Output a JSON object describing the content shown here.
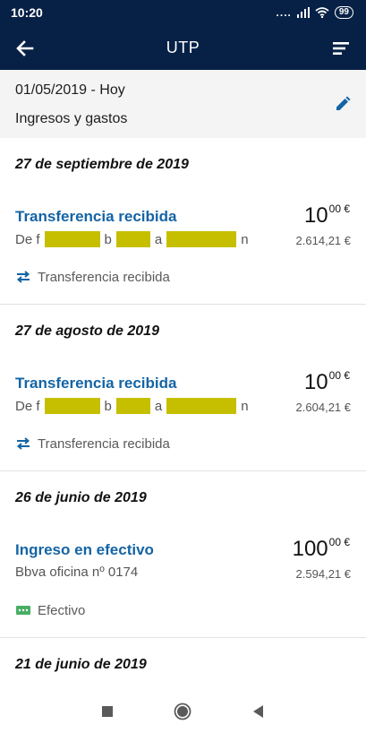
{
  "status_bar": {
    "time": "10:20",
    "signal": "....",
    "battery": "99"
  },
  "header": {
    "title": "UTP"
  },
  "filter": {
    "date_range": "01/05/2019 - Hoy",
    "type": "Ingresos y gastos"
  },
  "groups": [
    {
      "date": "27 de septiembre de 2019",
      "transaction": {
        "title": "Transferencia recibida",
        "desc_parts": [
          "De f",
          "b",
          "a",
          "n"
        ],
        "amount_int": "10",
        "amount_dec": "00 €",
        "balance": "2.614,21 €",
        "category": "Transferencia recibida",
        "category_icon": "transfer-icon"
      }
    },
    {
      "date": "27 de agosto de 2019",
      "transaction": {
        "title": "Transferencia recibida",
        "desc_parts": [
          "De f",
          "b",
          "a",
          "n"
        ],
        "amount_int": "10",
        "amount_dec": "00 €",
        "balance": "2.604,21 €",
        "category": "Transferencia recibida",
        "category_icon": "transfer-icon"
      }
    },
    {
      "date": "26 de junio de 2019",
      "transaction": {
        "title": "Ingreso en efectivo",
        "description": "Bbva oficina nº 0174",
        "amount_int": "100",
        "amount_dec": "00 €",
        "balance": "2.594,21 €",
        "category": "Efectivo",
        "category_icon": "cash-icon"
      }
    },
    {
      "date": "21 de junio de 2019"
    }
  ],
  "colors": {
    "header_bg": "#072146",
    "accent": "#1464a5",
    "redaction": "#c6bf00",
    "cash_icon": "#48ae64"
  }
}
